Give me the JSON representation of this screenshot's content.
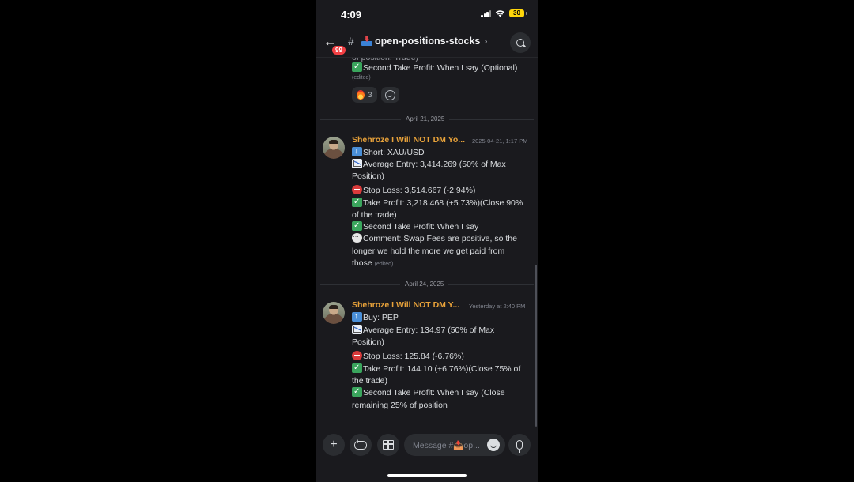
{
  "status_bar": {
    "time": "4:09",
    "battery": "30"
  },
  "header": {
    "unread_count": "99",
    "hash": "#",
    "channel_name": "open-positions-stocks",
    "chevron": "›"
  },
  "messages": {
    "top_partial": {
      "line_cut": "of position, Trade)",
      "second_tp": "Second Take Profit: When I say (Optional)",
      "edited": "(edited)",
      "reaction_count": "3"
    },
    "date_1": "April 21, 2025",
    "msg_1": {
      "username": "Shehroze I Will NOT DM Yo...",
      "timestamp": "2025-04-21, 1:17 PM",
      "lines": [
        "Short: XAU/USD",
        "Average Entry: 3,414.269 (50% of Max",
        "Position)",
        "Stop Loss: 3,514.667 (-2.94%)",
        "Take Profit: 3,218.468 (+5.73%)(Close 90%",
        "of the trade)",
        "Second Take Profit: When I say",
        "Comment: Swap Fees are positive, so the",
        "longer we hold the more we get paid from",
        "those"
      ],
      "edited": "(edited)"
    },
    "date_2": "April 24, 2025",
    "msg_2": {
      "username": "Shehroze I Will NOT DM Y...",
      "timestamp": "Yesterday at 2:40 PM",
      "lines": [
        "Buy: PEP",
        "Average Entry: 134.97 (50% of Max",
        "Position)",
        "Stop Loss: 125.84 (-6.76%)",
        "Take Profit: 144.10 (+6.76%)(Close 75% of",
        "the trade)",
        "Second Take Profit: When I say (Close",
        "remaining 25% of position"
      ]
    }
  },
  "composer": {
    "placeholder": "Message #📥op...",
    "plus": "+"
  },
  "colors": {
    "background": "#1a1a1e",
    "username": "#e8a23a",
    "badge": "#f23f43",
    "battery": "#ffd60a"
  },
  "icons": [
    "back-arrow-icon",
    "hash-icon",
    "inbox-tray-icon",
    "search-icon",
    "plus-icon",
    "gamepad-icon",
    "gift-icon",
    "emoji-icon",
    "microphone-icon"
  ]
}
